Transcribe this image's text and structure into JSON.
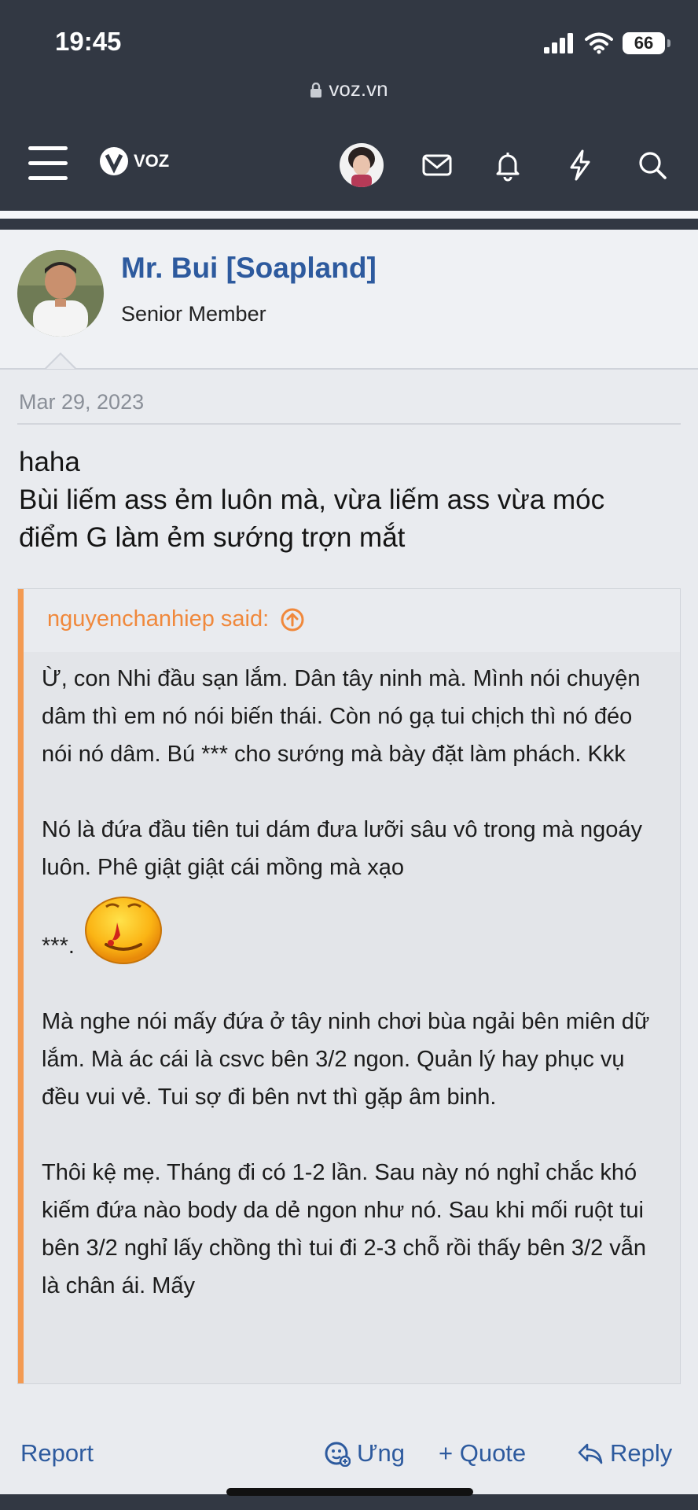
{
  "status": {
    "time": "19:45",
    "battery": "66"
  },
  "browser": {
    "url": "voz.vn"
  },
  "nav": {
    "logo_text": "voz"
  },
  "post": {
    "author": "Mr. Bui [Soapland]",
    "author_title": "Senior Member",
    "date": "Mar 29, 2023",
    "message_lines": [
      "haha",
      "Bùi liếm ass ẻm luôn mà, vừa liếm ass vừa móc",
      "điểm G làm ẻm sướng trợn mắt"
    ],
    "quote": {
      "author": "nguyenchanhiep said:",
      "paragraphs": [
        "Ừ, con Nhi đầu sạn lắm. Dân tây ninh mà. Mình nói chuyện dâm thì em nó nói biến thái. Còn nó gạ tui chịch thì nó đéo nói nó dâm. Bú *** cho sướng mà bày đặt làm phách. Kkk",
        "Nó là đứa đầu tiên tui dám đưa lưỡi sâu vô trong mà ngoáy luôn. Phê giật giật cái mồng mà xạo",
        "***.",
        "Mà nghe nói mấy đứa ở tây ninh chơi bùa ngải bên miên dữ lắm. Mà ác cái là csvc bên 3/2 ngon. Quản lý hay phục vụ đều vui vẻ. Tui sợ đi bên nvt thì gặp âm binh.",
        "Thôi kệ mẹ. Tháng đi có 1-2 lần. Sau này nó nghỉ chắc khó kiếm đứa nào body da dẻ ngon như nó. Sau khi mối ruột tui bên 3/2 nghỉ lấy chồng thì tui đi 2-3 chỗ rồi thấy bên 3/2 vẫn là chân ái. Mấy"
      ]
    },
    "actions": {
      "report": "Report",
      "react": "Ưng",
      "quote": "+ Quote",
      "reply": "Reply"
    }
  },
  "colors": {
    "header_bg": "#323843",
    "link": "#2d5a9e",
    "quote_accent": "#f39a52"
  }
}
